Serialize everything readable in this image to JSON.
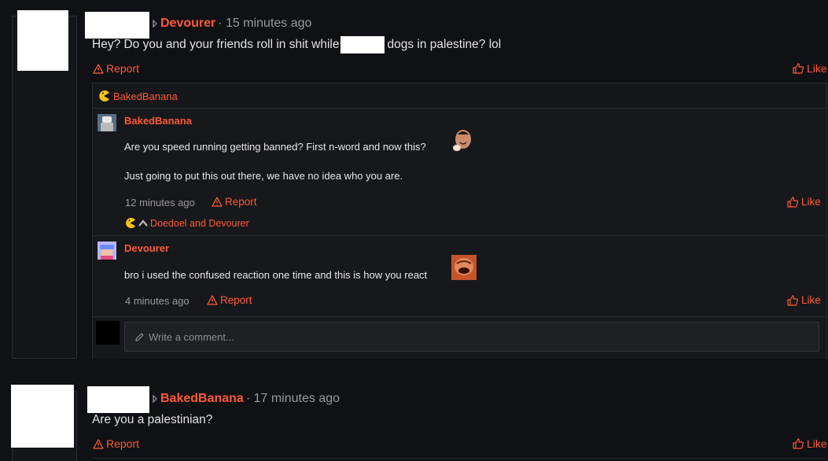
{
  "post1": {
    "author": "Devourer",
    "time": "· 15 minutes ago",
    "text_before": "Hey? Do you and your friends roll in shit while",
    "text_after": "dogs in palestine? lol",
    "report_label": "Report",
    "like_label": "Like"
  },
  "reaction_bar": {
    "name": "BakedBanana"
  },
  "reply1": {
    "author": "BakedBanana",
    "line1": "Are you speed running getting banned? First n-word and now this?",
    "line2": "Just going to put this out there, we have no idea who you are.",
    "time": "12 minutes ago",
    "report_label": "Report",
    "like_label": "Like",
    "reactions": "Doedoel and Devourer"
  },
  "reply2": {
    "author": "Devourer",
    "text": "bro i used the confused reaction one time and this is how you react",
    "time": "4 minutes ago",
    "report_label": "Report",
    "like_label": "Like"
  },
  "comment_input": {
    "placeholder": "Write a comment..."
  },
  "post2": {
    "author": "BakedBanana",
    "time": "· 17 minutes ago",
    "text": "Are you a palestinian?",
    "report_label": "Report",
    "like_label": "Like"
  },
  "colors": {
    "accent": "#ff5a36",
    "background": "#101114",
    "panel": "#16171a"
  }
}
